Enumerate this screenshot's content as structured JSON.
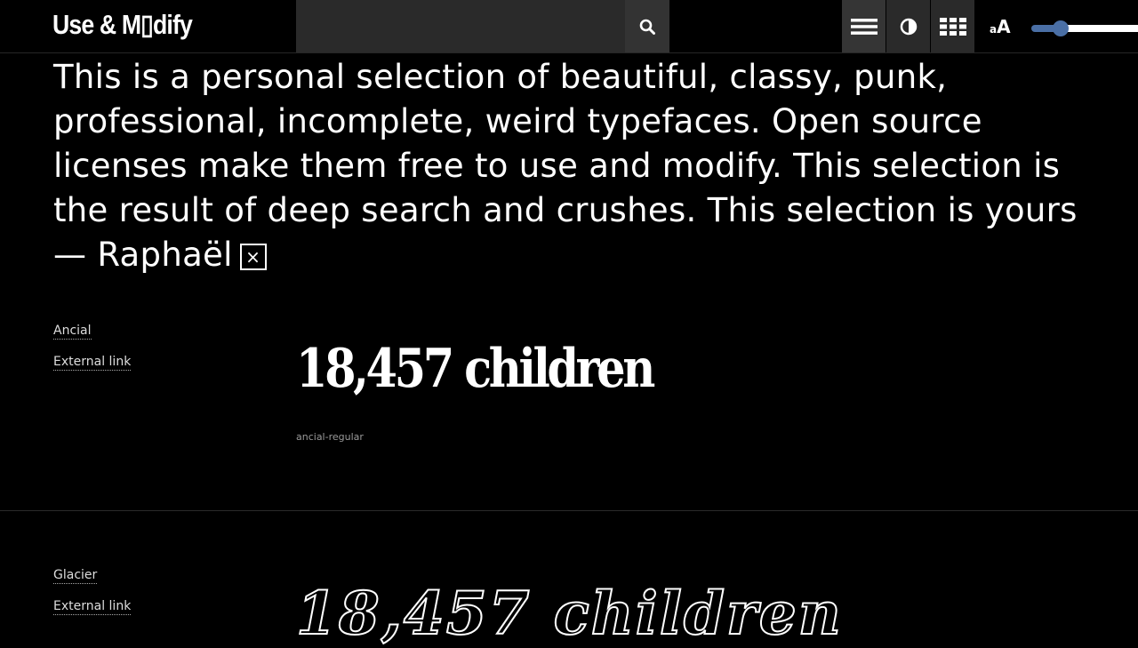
{
  "header": {
    "brand": "Use & M▯dify",
    "search_value": "",
    "size_small": "a",
    "size_big": "A",
    "font_size_slider": 0.2
  },
  "icons": {
    "search": "search-icon",
    "list": "list-view-icon",
    "contrast": "contrast-icon",
    "grid": "grid-view-icon",
    "close": "close-icon"
  },
  "colors": {
    "background": "#000000",
    "text": "#ffffff",
    "slider_accent": "#4a6fa5",
    "search_bg": "#2a2a2a"
  },
  "intro": {
    "text": "This is a personal selection of beautiful, classy, punk, professional, incomplete, weird typefaces. Open source licenses make them free to use and modify. This selection is the result of deep search and crushes. This selection is yours — Raphaël",
    "close_label": "×"
  },
  "fonts": [
    {
      "name": "Ancial",
      "external_link": "External link",
      "specimen": "18,457 children",
      "id": "ancial-regular"
    },
    {
      "name": "Glacier",
      "external_link": "External link",
      "specimen": "18,457 children"
    }
  ]
}
